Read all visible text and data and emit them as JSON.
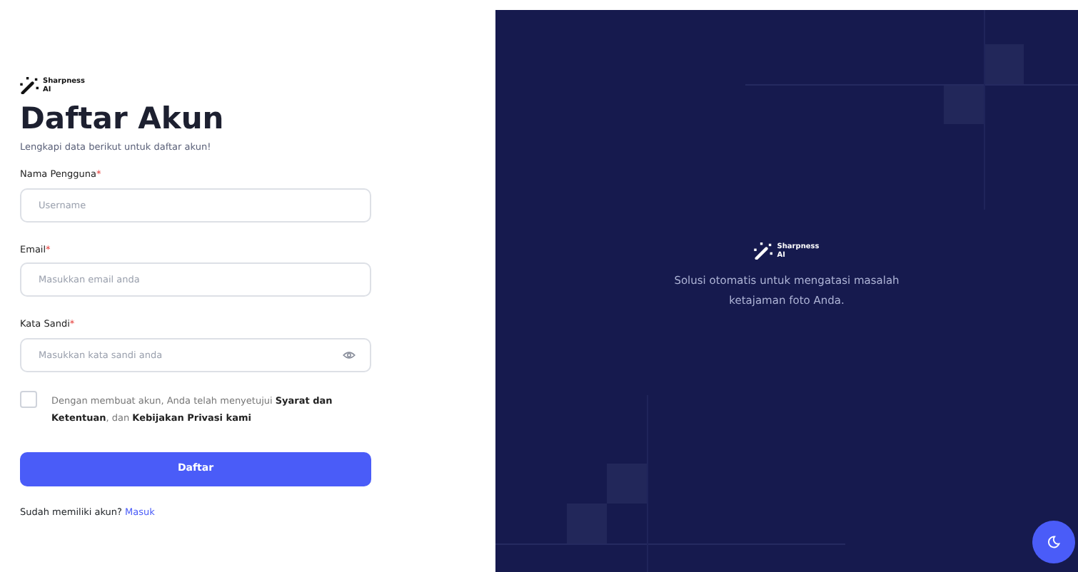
{
  "brand": {
    "name": "Sharpness",
    "suffix": "AI"
  },
  "form": {
    "title": "Daftar Akun",
    "subtitle": "Lengkapi data berikut untuk daftar akun!",
    "fields": [
      {
        "label": "Nama Pengguna",
        "required_mark": "*",
        "placeholder": "Username",
        "kind": "text"
      },
      {
        "label": "Email",
        "required_mark": "*",
        "placeholder": "Masukkan email anda",
        "kind": "email"
      },
      {
        "label": "Kata Sandi",
        "required_mark": "*",
        "placeholder": "Masukkan kata sandi anda",
        "kind": "password"
      }
    ],
    "agreement": {
      "checked": false,
      "text": "Dengan membuat akun, Anda telah menyetujui **Syarat dan Ketentuan**, dan **Kebijakan Privasi kami**"
    },
    "submit": "Daftar",
    "login_prompt": {
      "text": "Sudah memiliki akun?",
      "link": "Masuk"
    }
  },
  "hero": {
    "brand": {
      "name": "Sharpness",
      "suffix": "AI"
    },
    "tagline": "Solusi otomatis untuk mengatasi masalah ketajaman foto Anda."
  }
}
